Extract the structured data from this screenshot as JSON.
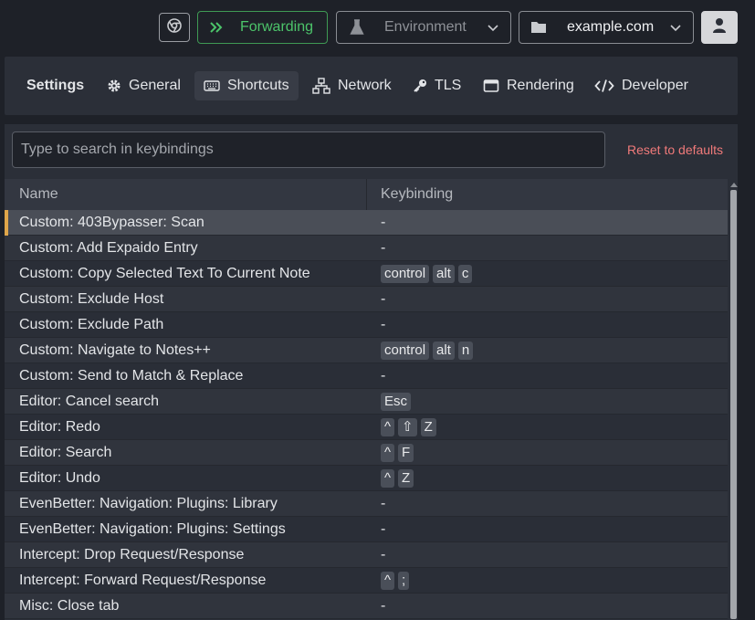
{
  "topbar": {
    "forwarding_label": "Forwarding",
    "environment_label": "Environment",
    "domain_label": "example.com"
  },
  "tabs": {
    "title": "Settings",
    "general": "General",
    "shortcuts": "Shortcuts",
    "network": "Network",
    "tls": "TLS",
    "rendering": "Rendering",
    "developer": "Developer"
  },
  "search": {
    "placeholder": "Type to search in keybindings",
    "value": ""
  },
  "reset_label": "Reset to defaults",
  "table": {
    "headers": {
      "name": "Name",
      "keybinding": "Keybinding"
    },
    "rows": [
      {
        "name": "Custom: 403Bypasser: Scan",
        "keys": []
      },
      {
        "name": "Custom: Add Expaido Entry",
        "keys": []
      },
      {
        "name": "Custom: Copy Selected Text To Current Note",
        "keys": [
          "control",
          "alt",
          "c"
        ]
      },
      {
        "name": "Custom: Exclude Host",
        "keys": []
      },
      {
        "name": "Custom: Exclude Path",
        "keys": []
      },
      {
        "name": "Custom: Navigate to Notes++",
        "keys": [
          "control",
          "alt",
          "n"
        ]
      },
      {
        "name": "Custom: Send to Match & Replace",
        "keys": []
      },
      {
        "name": "Editor: Cancel search",
        "keys": [
          "Esc"
        ]
      },
      {
        "name": "Editor: Redo",
        "keys": [
          "^",
          "⇧",
          "Z"
        ]
      },
      {
        "name": "Editor: Search",
        "keys": [
          "^",
          "F"
        ]
      },
      {
        "name": "Editor: Undo",
        "keys": [
          "^",
          "Z"
        ]
      },
      {
        "name": "EvenBetter: Navigation: Plugins: Library",
        "keys": []
      },
      {
        "name": "EvenBetter: Navigation: Plugins: Settings",
        "keys": []
      },
      {
        "name": "Intercept: Drop Request/Response",
        "keys": []
      },
      {
        "name": "Intercept: Forward Request/Response",
        "keys": [
          "^",
          ";"
        ]
      },
      {
        "name": "Misc: Close tab",
        "keys": []
      }
    ],
    "empty_marker": "-",
    "selected_index": 0
  },
  "colors": {
    "accent_green": "#4cc46a",
    "reset_red": "#f07a7a",
    "selected_marker": "#e0a64a"
  }
}
